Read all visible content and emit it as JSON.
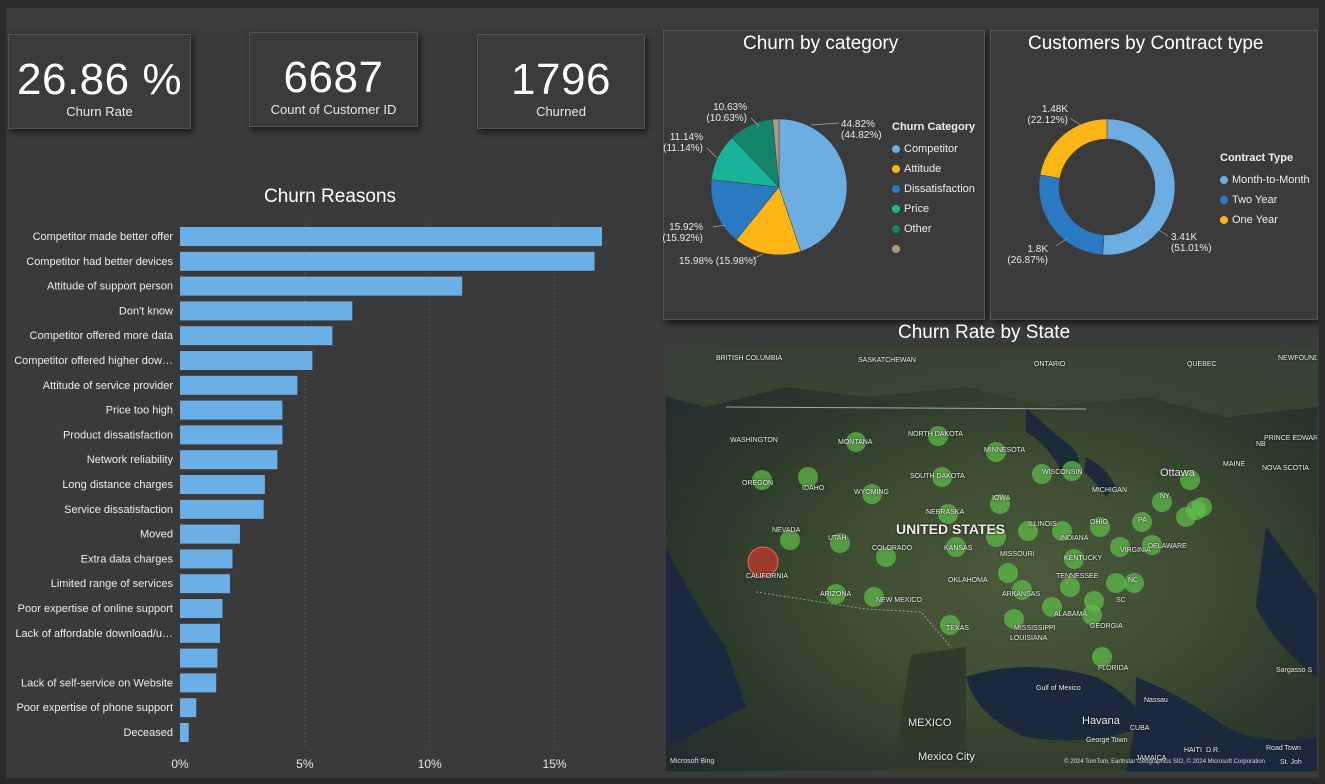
{
  "kpis": [
    {
      "value": "26.86 %",
      "label": "Churn Rate"
    },
    {
      "value": "6687",
      "label": "Count of Customer ID"
    },
    {
      "value": "1796",
      "label": "Churned"
    }
  ],
  "colors": {
    "bar": "#6ab0e6",
    "competitor": "#6cade2",
    "attitude": "#fbb515",
    "dissatisfaction": "#2a7ac3",
    "price": "#18b49a",
    "other": "#13836a",
    "blank": "#b09a77",
    "month": "#6cade2",
    "twoyear": "#2a7ac3",
    "oneyear": "#fbb515"
  },
  "chart_data": [
    {
      "type": "bar",
      "title": "Churn Reasons",
      "categories": [
        "Competitor made better offer",
        "Competitor had better devices",
        "Attitude of support person",
        "Don't know",
        "Competitor offered more data",
        "Competitor offered higher dow…",
        "Attitude of service provider",
        "Price too high",
        "Product dissatisfaction",
        "Network reliability",
        "Long distance charges",
        "Service dissatisfaction",
        "Moved",
        "Extra data charges",
        "Limited range of services",
        "Poor expertise of online support",
        "Lack of affordable download/u…",
        "",
        "Lack of self-service on Website",
        "Poor expertise of phone support",
        "Deceased"
      ],
      "values": [
        16.9,
        16.6,
        11.3,
        6.9,
        6.1,
        5.3,
        4.7,
        4.1,
        4.1,
        3.9,
        3.4,
        3.35,
        2.4,
        2.1,
        2.0,
        1.7,
        1.6,
        1.5,
        1.45,
        0.65,
        0.35
      ],
      "xticks": [
        "0%",
        "5%",
        "10%",
        "15%"
      ],
      "xlim": [
        0,
        17.5
      ]
    },
    {
      "type": "pie",
      "title": "Churn by category",
      "legend_title": "Churn Category",
      "slices": [
        {
          "name": "Competitor",
          "value": 44.82,
          "label": "44.82%",
          "label2": "(44.82%)",
          "color_key": "competitor"
        },
        {
          "name": "Attitude",
          "value": 15.98,
          "label": "15.98% (15.98%)",
          "label2": "",
          "color_key": "attitude"
        },
        {
          "name": "Dissatisfaction",
          "value": 15.92,
          "label": "15.92%",
          "label2": "(15.92%)",
          "color_key": "dissatisfaction"
        },
        {
          "name": "Price",
          "value": 11.14,
          "label": "11.14%",
          "label2": "(11.14%)",
          "color_key": "price"
        },
        {
          "name": "Other",
          "value": 10.63,
          "label": "10.63%",
          "label2": "(10.63%)",
          "color_key": "other"
        },
        {
          "name": "",
          "value": 1.51,
          "label": "",
          "label2": "",
          "color_key": "blank"
        }
      ]
    },
    {
      "type": "pie",
      "title": "Customers by Contract type",
      "legend_title": "Contract Type",
      "slices": [
        {
          "name": "Month-to-Month",
          "value": 51.01,
          "label": "3.41K",
          "label2": "(51.01%)",
          "color_key": "month"
        },
        {
          "name": "Two Year",
          "value": 26.87,
          "label": "1.8K",
          "label2": "(26.87%)",
          "color_key": "twoyear"
        },
        {
          "name": "One Year",
          "value": 22.12,
          "label": "1.48K",
          "label2": "(22.12%)",
          "color_key": "oneyear"
        }
      ]
    }
  ],
  "map": {
    "title": "Churn Rate by State",
    "country_label": "UNITED STATES",
    "places": [
      "BRITISH COLUMBIA",
      "SASKATCHEWAN",
      "ONTARIO",
      "QUEBEC",
      "NEWFOUNDLAND AND LABRADOR",
      "WASHINGTON",
      "MONTANA",
      "NORTH DAKOTA",
      "MINNESOTA",
      "WISCONSIN",
      "MICHIGAN",
      "OREGON",
      "IDAHO",
      "WYOMING",
      "SOUTH DAKOTA",
      "IOWA",
      "NEBRASKA",
      "NEVADA",
      "UTAH",
      "COLORADO",
      "KANSAS",
      "MISSOURI",
      "ILLINOIS",
      "INDIANA",
      "OHIO",
      "PA",
      "NY",
      "CALIFORNIA",
      "ARIZONA",
      "NEW MEXICO",
      "OKLAHOMA",
      "ARKANSAS",
      "TENNESSEE",
      "KENTUCKY",
      "VIRGINIA",
      "NC",
      "SC",
      "GEORGIA",
      "ALABAMA",
      "MISSISSIPPI",
      "LOUISIANA",
      "TEXAS",
      "FLORIDA",
      "MAINE",
      "NB",
      "PRINCE EDWARD ISLAND",
      "NOVA SCOTIA",
      "Ottawa",
      "Gulf of Mexico",
      "MEXICO",
      "Havana",
      "CUBA",
      "Nassau",
      "George Town",
      "JAMAICA",
      "HAITI",
      "D.R.",
      "Mexico City",
      "Sargasso S",
      "Road Town",
      "St. Joh",
      "DELAWARE"
    ],
    "bing": "Microsoft Bing",
    "credit": "© 2024 TomTom, Earthstar Geographics SIO, © 2024 Microsoft Corporation"
  }
}
